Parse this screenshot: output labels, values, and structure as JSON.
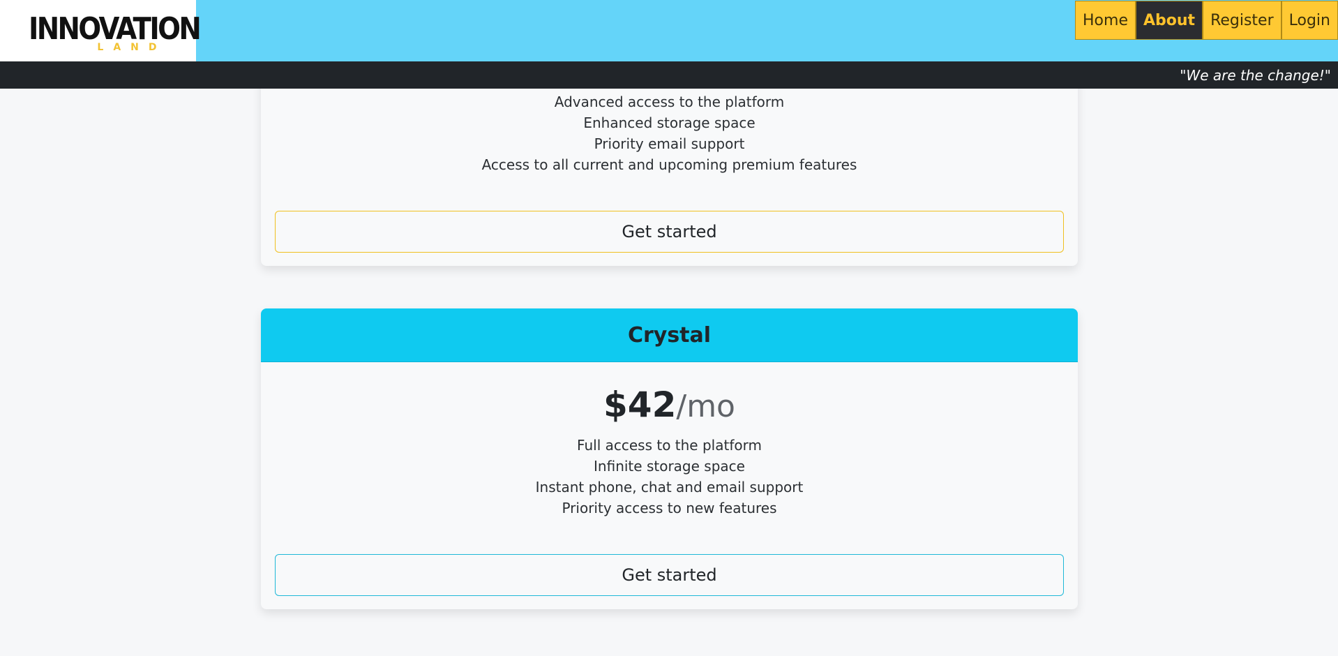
{
  "brand": {
    "logo_text": "INNOVATION",
    "logo_subtext": "LAND"
  },
  "nav": {
    "items": [
      {
        "label": "Home",
        "active": false
      },
      {
        "label": "About",
        "active": true
      },
      {
        "label": "Register",
        "active": false
      },
      {
        "label": "Login",
        "active": false
      }
    ]
  },
  "tagline": "\"We are the change!\"",
  "plans": [
    {
      "name": "",
      "features": [
        "Advanced access to the platform",
        "Enhanced storage space",
        "Priority email support",
        "Access to all current and upcoming premium features"
      ],
      "cta_label": "Get started",
      "accent_color": "#ffc107"
    },
    {
      "name": "Crystal",
      "price": "$42",
      "price_unit": "/mo",
      "features": [
        "Full access to the platform",
        "Infinite storage space",
        "Instant phone, chat and email support",
        "Priority access to new features"
      ],
      "cta_label": "Get started",
      "accent_color": "#0dcaf0"
    }
  ],
  "colors": {
    "header_bg": "#64d4f9",
    "nav_bg": "#ffc933",
    "nav_active_bg": "#2b2c30",
    "tagline_bar_bg": "#212529"
  }
}
